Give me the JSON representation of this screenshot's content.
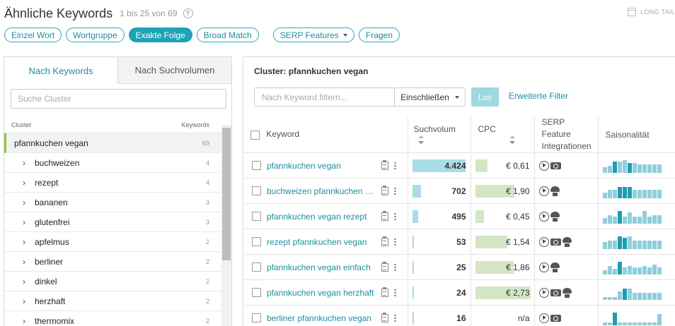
{
  "header": {
    "title": "Ähnliche Keywords",
    "range": "1 bis 25 von 69",
    "help_label": "?",
    "long_tail": "LONG TAIL"
  },
  "filters": [
    {
      "label": "Einzel Wort",
      "active": false
    },
    {
      "label": "Wortgruppe",
      "active": false
    },
    {
      "label": "Exakte Folge",
      "active": true
    },
    {
      "label": "Broad Match",
      "active": false
    },
    {
      "label": "SERP Features",
      "active": false
    },
    {
      "label": "Fragen",
      "active": false
    }
  ],
  "left": {
    "tabs": [
      "Nach Keywords",
      "Nach Suchvolumen"
    ],
    "search_placeholder": "Suche Cluster",
    "col_cluster": "Cluster",
    "col_keywords": "Keywords",
    "clusters": [
      {
        "name": "pfannkuchen vegan",
        "count": "69",
        "selected": true
      },
      {
        "name": "buchweizen",
        "count": "4"
      },
      {
        "name": "rezept",
        "count": "4"
      },
      {
        "name": "bananen",
        "count": "3"
      },
      {
        "name": "glutenfrei",
        "count": "3"
      },
      {
        "name": "apfelmus",
        "count": "2"
      },
      {
        "name": "berliner",
        "count": "2"
      },
      {
        "name": "dinkel",
        "count": "2"
      },
      {
        "name": "herzhaft",
        "count": "2"
      },
      {
        "name": "thermomix",
        "count": "2"
      }
    ]
  },
  "right": {
    "cluster_label": "Cluster:",
    "cluster_value": "pfannkuchen vegan",
    "filter_placeholder": "Nach Keyword filtern...",
    "include_label": "Einschließen",
    "go_label": "Los",
    "advanced_label": "Erweiterte Filter",
    "columns": {
      "keyword": "Keyword",
      "volume": "Suchvolum",
      "cpc": "CPC",
      "serp_1": "SERP Feature",
      "serp_2": "Integrationen",
      "season": "Saisonalität"
    },
    "rows": [
      {
        "keyword": "pfannkuchen vegan",
        "volume": "4.424",
        "volume_fraction": 1.0,
        "cpc": "€ 0,61",
        "cpc_fraction": 0.22,
        "serp": [
          "play-icon",
          "camera-icon"
        ],
        "season": [
          0.4,
          0.5,
          0.8,
          0.8,
          0.9,
          0.7,
          0.7,
          0.6,
          0.6,
          0.6,
          0.6,
          0.6
        ],
        "season_hi": [
          2,
          5
        ]
      },
      {
        "keyword": "buchweizen pfannkuchen vegan",
        "volume": "702",
        "volume_fraction": 0.16,
        "cpc": "€ 1,90",
        "cpc_fraction": 0.7,
        "serp": [
          "play-icon",
          "chef-hat-icon"
        ],
        "season": [
          0.4,
          0.6,
          0.6,
          0.8,
          0.8,
          0.8,
          0.6,
          0.6,
          0.6,
          0.6,
          0.6,
          0.6
        ],
        "season_hi": [
          3,
          4,
          5
        ]
      },
      {
        "keyword": "pfannkuchen vegan rezept",
        "volume": "495",
        "volume_fraction": 0.11,
        "cpc": "€ 0,45",
        "cpc_fraction": 0.16,
        "serp": [
          "play-icon",
          "chef-hat-icon"
        ],
        "season": [
          0.4,
          0.6,
          0.5,
          0.9,
          0.5,
          0.8,
          0.5,
          0.5,
          0.9,
          0.5,
          0.6,
          0.6
        ],
        "season_hi": [
          3
        ]
      },
      {
        "keyword": "rezept pfannkuchen vegan",
        "volume": "53",
        "volume_fraction": 0.012,
        "cpc": "€ 1,54",
        "cpc_fraction": 0.58,
        "serp": [
          "play-icon",
          "camera-icon",
          "chef-hat-icon"
        ],
        "season": [
          0.5,
          0.6,
          0.6,
          0.9,
          0.8,
          0.9,
          0.6,
          0.6,
          0.6,
          0.6,
          0.6,
          0.6
        ],
        "season_hi": [
          3,
          4
        ]
      },
      {
        "keyword": "pfannkuchen vegan einfach",
        "volume": "25",
        "volume_fraction": 0.006,
        "cpc": "€ 1,86",
        "cpc_fraction": 0.69,
        "serp": [
          "play-icon",
          "chef-hat-icon"
        ],
        "season": [
          0.3,
          0.6,
          0.4,
          0.9,
          0.5,
          0.6,
          0.5,
          0.5,
          0.6,
          0.5,
          0.7,
          0.5
        ],
        "season_hi": [
          3
        ]
      },
      {
        "keyword": "pfannkuchen vegan herzhaft",
        "volume": "24",
        "volume_fraction": 0.005,
        "cpc": "€ 2,73",
        "cpc_fraction": 1.0,
        "serp": [
          "play-icon",
          "camera-icon",
          "chef-hat-icon"
        ],
        "season": [
          0.2,
          0.2,
          0.2,
          0.6,
          0.8,
          0.8,
          0.5,
          0.5,
          0.5,
          0.5,
          0.5,
          0.5
        ],
        "season_hi": [
          4
        ]
      },
      {
        "keyword": "berliner pfannkuchen vegan",
        "volume": "16",
        "volume_fraction": 0.004,
        "cpc": "n/a",
        "cpc_fraction": 0,
        "serp": [
          "play-icon",
          "camera-icon"
        ],
        "season": [
          0.2,
          0.2,
          0.9,
          0.2,
          0.2,
          0.2,
          0.2,
          0.2,
          0.2,
          0.2,
          0.2,
          0.8
        ],
        "season_hi": [
          2
        ]
      }
    ]
  }
}
